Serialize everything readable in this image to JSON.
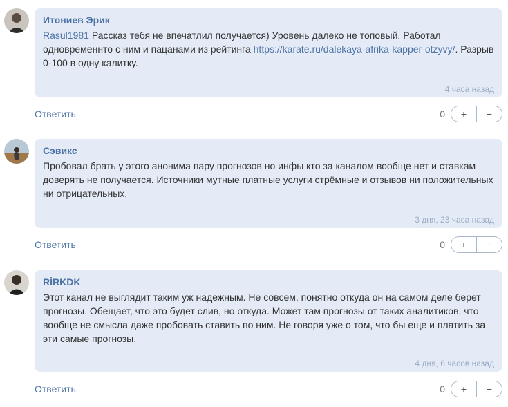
{
  "comments": [
    {
      "author": "Итониев Эрик",
      "mention": "Rasul1981",
      "text_before_link": " Рассказ тебя не впечатлил получается) Уровень далеко не топовый. Работал одновременнто с ним и пацанами из рейтинга ",
      "link": "https://karate.ru/dalekaya-afrika-kapper-otzyvy/",
      "text_after_link": ". Разрыв 0-100 в одну калитку.",
      "time": "4 часа назад",
      "reply_label": "Ответить",
      "votes": "0",
      "plus": "+",
      "minus": "−",
      "avatar_icon": "user-photo-icon"
    },
    {
      "author": "Сэвикс",
      "text": "Пробовал брать у этого анонима пару прогнозов но инфы кто за каналом вообще нет и ставкам доверять не получается. Источники мутные платные услуги стрёмные и отзывов ни положительных ни отрицательных.",
      "time": "3 дня, 23 часа назад",
      "reply_label": "Ответить",
      "votes": "0",
      "plus": "+",
      "minus": "−",
      "avatar_icon": "user-photo-icon"
    },
    {
      "author": "RİRKDK",
      "text": "Этот канал не выглядит таким уж надежным. Не совсем, понятно откуда он на самом деле берет прогнозы. Обещает, что это будет слив, но откуда. Может там прогнозы от таких аналитиков, что вообще не смысла даже пробовать ставить по ним. Не говоря уже о том, что бы еще и платить за эти самые прогнозы.",
      "time": "4 дня, 6 часов назад",
      "reply_label": "Ответить",
      "votes": "0",
      "plus": "+",
      "minus": "−",
      "avatar_icon": "user-photo-icon"
    }
  ],
  "colors": {
    "bubble_bg": "#e4ebf6",
    "accent": "#4d73a5",
    "time": "#9bacc5"
  }
}
